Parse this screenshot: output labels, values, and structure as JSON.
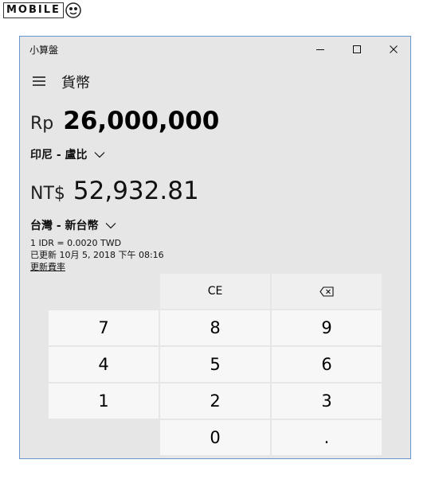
{
  "watermark": {
    "text": "MOBILE"
  },
  "window": {
    "title": "小算盤",
    "controls": {
      "minimize": "minimize",
      "maximize": "maximize",
      "close": "close"
    }
  },
  "header": {
    "mode": "貨幣"
  },
  "from": {
    "symbol": "Rp",
    "value": "26,000,000",
    "currency": "印尼 - 盧比"
  },
  "to": {
    "symbol": "NT$",
    "value": "52,932.81",
    "currency": "台灣 - 新台幣"
  },
  "rate": {
    "line1": "1 IDR = 0.0020 TWD",
    "line2": "已更新 10月 5, 2018 下午 08:16",
    "link": "更新費率"
  },
  "keypad": {
    "ce": "CE",
    "backspace_icon": "backspace-icon",
    "k7": "7",
    "k8": "8",
    "k9": "9",
    "k4": "4",
    "k5": "5",
    "k6": "6",
    "k1": "1",
    "k2": "2",
    "k3": "3",
    "k0": "0",
    "decimal": "."
  },
  "colors": {
    "window_bg": "#e6e6e6",
    "window_border": "#6a95c8",
    "key_bg": "#f7f7f7",
    "fn_key_bg": "#efefef"
  }
}
